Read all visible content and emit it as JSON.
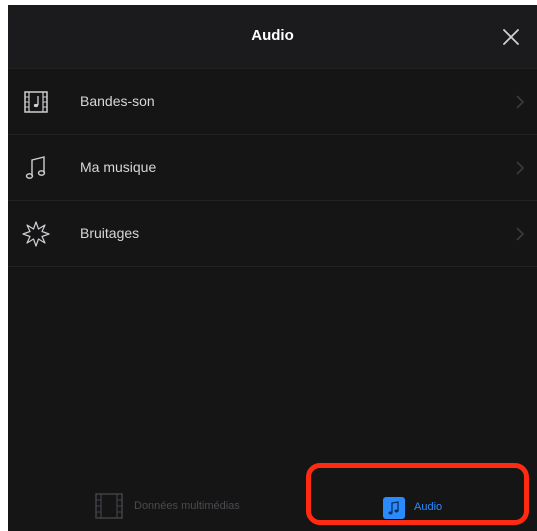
{
  "header": {
    "title": "Audio",
    "close_icon": "close-icon"
  },
  "list": {
    "items": [
      {
        "label": "Bandes-son",
        "icon": "film-music-icon"
      },
      {
        "label": "Ma musique",
        "icon": "music-note-icon"
      },
      {
        "label": "Bruitages",
        "icon": "burst-icon"
      }
    ]
  },
  "tabs": [
    {
      "label": "Données multimédias",
      "icon": "film-strip-icon",
      "selected": false
    },
    {
      "label": "Audio",
      "icon": "music-note-icon",
      "selected": true
    }
  ],
  "colors": {
    "background": "#151516",
    "header": "#1b1b1d",
    "text": "#d7d7da",
    "accent": "#2a8bff",
    "highlight": "#ff2a12"
  }
}
